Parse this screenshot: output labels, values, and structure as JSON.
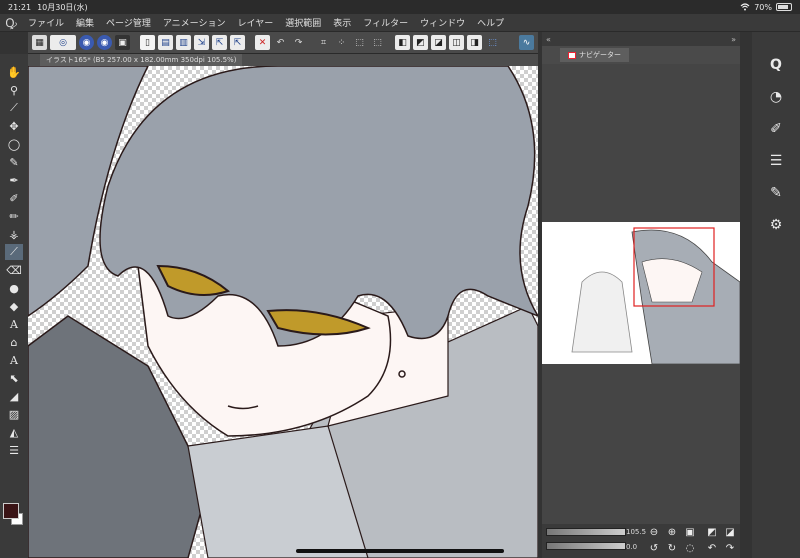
{
  "status": {
    "time": "21:21",
    "date": "10月30日(水)",
    "wifi": "wifi-icon",
    "battery_text": "70%",
    "battery_level": 0.7
  },
  "menu": {
    "logo": "clip-studio-logo-icon",
    "items": [
      "ファイル",
      "編集",
      "ページ管理",
      "アニメーション",
      "レイヤー",
      "選択範囲",
      "表示",
      "フィルター",
      "ウィンドウ",
      "ヘルプ"
    ]
  },
  "toolbar": {
    "icons": [
      "app-icon",
      "spiral-icon",
      "sphere-icon",
      "sphere-icon-2",
      "save-icon",
      "new-icon",
      "open-icon",
      "save-icon-2",
      "import-icon",
      "export-icon",
      "export-icon-2",
      "print-icon",
      "clear-icon",
      "undo-icon",
      "redo-icon",
      "transform-icon",
      "grid-icon",
      "select-all-icon",
      "deselect-icon",
      "invert-icon",
      "fill-icon",
      "expand-icon",
      "shrink-icon",
      "ruler-icon",
      "show-selection-icon",
      "curve-icon"
    ]
  },
  "canvas": {
    "tab_label": "イラスト165* (B5 257.00 x 182.00mm 350dpi 105.5%)"
  },
  "left_tools": [
    "hand-icon",
    "zoom-icon",
    "eyedropper-icon",
    "move-icon",
    "lasso-icon",
    "select-icon",
    "pen-icon",
    "brush-icon",
    "pencil-icon",
    "airbrush-icon",
    "decoration-icon",
    "eraser-icon",
    "fill-icon",
    "blend-icon",
    "text-icon",
    "balloon-icon",
    "text-icon-2",
    "ruler-icon",
    "gradient-icon",
    "figure-icon",
    "frame-icon",
    "correct-line-icon"
  ],
  "navigator": {
    "tab_label": "ナビゲーター",
    "zoom_value": "105.5",
    "rotation_value": "0.0"
  },
  "right_panel_icons": [
    "sub-tool-icon",
    "color-circle-icon",
    "brush-size-icon",
    "layer-icon",
    "tool-property-icon",
    "settings-icon"
  ],
  "colors": {
    "main": "#3a1416",
    "sub": "#ffffff",
    "hair": "#9aa1ab",
    "skin": "#fdf6f4",
    "eyes": "#c09a2a"
  }
}
